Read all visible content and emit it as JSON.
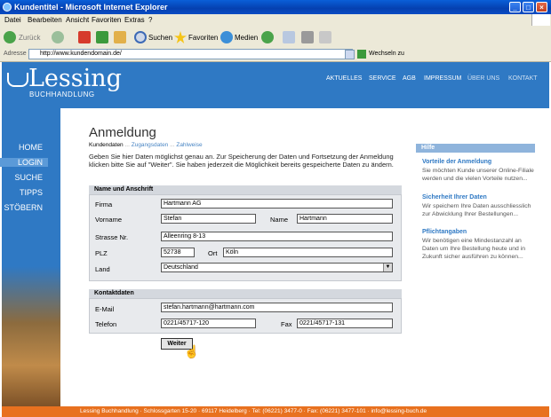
{
  "window": {
    "title": "Kundentitel - Microsoft Internet Explorer"
  },
  "menu": [
    "Datei",
    "Bearbeiten",
    "Ansicht",
    "Favoriten",
    "Extras",
    "?"
  ],
  "toolbar": {
    "back": "Zurück",
    "search": "Suchen",
    "favorites": "Favoriten",
    "media": "Medien"
  },
  "address": {
    "label": "Adresse",
    "url": "http://www.kundendomain.de/",
    "go": "Wechseln zu"
  },
  "site": {
    "logo": "Lessing",
    "logo_sub": "BUCHHANDLUNG",
    "topnav": [
      "AKTUELLES",
      "SERVICE",
      "AGB",
      "IMPRESSUM",
      "ÜBER UNS",
      "KONTAKT"
    ],
    "sidenav": [
      "HOME",
      "LOGIN",
      "SUCHE",
      "TIPPS",
      "STÖBERN"
    ]
  },
  "page": {
    "title": "Anmeldung",
    "breadcrumb": [
      "Kundendaten",
      "Zugangsdaten",
      "Zahlweise"
    ],
    "intro": "Geben Sie hier Daten möglichst genau an. Zur Speicherung der Daten und Fortsetzung der Anmeldung klicken bitte Sie auf \"Weiter\". Sie haben jederzeit die Möglichkeit bereits gespeicherte Daten zu ändern."
  },
  "form": {
    "section1": "Name und Anschrift",
    "firma_label": "Firma",
    "firma_value": "Hartmann AG",
    "vorname_label": "Vorname",
    "vorname_value": "Stefan",
    "name_label": "Name",
    "name_value": "Hartmann",
    "strasse_label": "Strasse Nr.",
    "strasse_value": "Alleenring 8-13",
    "plz_label": "PLZ",
    "plz_value": "52738",
    "ort_label": "Ort",
    "ort_value": "Köln",
    "land_label": "Land",
    "land_value": "Deutschland",
    "section2": "Kontaktdaten",
    "email_label": "E-Mail",
    "email_value": "stefan.hartmann@hartmann.com",
    "telefon_label": "Telefon",
    "telefon_value": "0221/45717-120",
    "fax_label": "Fax",
    "fax_value": "0221/45717-131",
    "submit": "Weiter"
  },
  "help": {
    "header": "Hilfe",
    "items": [
      {
        "title": "Vorteile der Anmeldung",
        "text": "Sie möchten Kunde unserer Online-Filiale werden und die vielen Vorteile nutzen..."
      },
      {
        "title": "Sicherheit Ihrer Daten",
        "text": "Wir speichern Ihre Daten ausschliesslich zur Abwicklung Ihrer Bestellungen..."
      },
      {
        "title": "Pflichtangaben",
        "text": "Wir benötigen eine Mindestanzahl an Daten um Ihre Bestellung heute und in Zukunft sicher ausführen zu können..."
      }
    ]
  },
  "footer": {
    "text": "Lessing Buchhandlung  ·  Schlossgarten 15-20  ·  69117 Heidelberg  ·  Tel: (06221) 3477-0  ·  Fax: (06221) 3477-101  ·  info@lessing-buch.de"
  },
  "colors": {
    "brand_blue": "#2f79c4",
    "footer_orange": "#e8711f",
    "help_blue": "#8fb4dc"
  }
}
